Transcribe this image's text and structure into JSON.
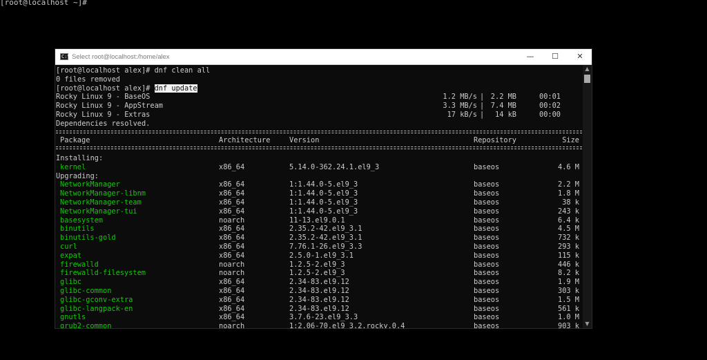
{
  "background_prompt": "[root@localhost ~]#",
  "window": {
    "title": "Select root@localhost:/home/alex",
    "icon_label": "C:\\",
    "minimize_glyph": "—",
    "maximize_glyph": "☐",
    "close_glyph": "✕"
  },
  "terminal": {
    "cmd1": "[root@localhost alex]# dnf clean all",
    "cmd1_output": "0 files removed",
    "cmd2_prompt": "[root@localhost alex]# ",
    "cmd2_command": "dnf update",
    "repos": [
      {
        "name": "Rocky Linux 9 - BaseOS",
        "speed": "1.2 MB/s",
        "size": "2.2 MB",
        "time": "00:01"
      },
      {
        "name": "Rocky Linux 9 - AppStream",
        "speed": "3.3 MB/s",
        "size": "7.4 MB",
        "time": "00:02"
      },
      {
        "name": "Rocky Linux 9 - Extras",
        "speed": "17 kB/s",
        "size": "14 kB",
        "time": "00:00"
      }
    ],
    "deps_resolved": "Dependencies resolved.",
    "headers": {
      "package": "Package",
      "architecture": "Architecture",
      "version": "Version",
      "repository": "Repository",
      "size": "Size"
    },
    "installing_label": "Installing:",
    "upgrading_label": "Upgrading:",
    "installing": [
      {
        "package": "kernel",
        "arch": "x86_64",
        "version": "5.14.0-362.24.1.el9_3",
        "repo": "baseos",
        "size": "4.6 M"
      }
    ],
    "upgrading": [
      {
        "package": "NetworkManager",
        "arch": "x86_64",
        "version": "1:1.44.0-5.el9_3",
        "repo": "baseos",
        "size": "2.2 M"
      },
      {
        "package": "NetworkManager-libnm",
        "arch": "x86_64",
        "version": "1:1.44.0-5.el9_3",
        "repo": "baseos",
        "size": "1.8 M"
      },
      {
        "package": "NetworkManager-team",
        "arch": "x86_64",
        "version": "1:1.44.0-5.el9_3",
        "repo": "baseos",
        "size": "38 k"
      },
      {
        "package": "NetworkManager-tui",
        "arch": "x86_64",
        "version": "1:1.44.0-5.el9_3",
        "repo": "baseos",
        "size": "243 k"
      },
      {
        "package": "basesystem",
        "arch": "noarch",
        "version": "11-13.el9.0.1",
        "repo": "baseos",
        "size": "6.4 k"
      },
      {
        "package": "binutils",
        "arch": "x86_64",
        "version": "2.35.2-42.el9_3.1",
        "repo": "baseos",
        "size": "4.5 M"
      },
      {
        "package": "binutils-gold",
        "arch": "x86_64",
        "version": "2.35.2-42.el9_3.1",
        "repo": "baseos",
        "size": "732 k"
      },
      {
        "package": "curl",
        "arch": "x86_64",
        "version": "7.76.1-26.el9_3.3",
        "repo": "baseos",
        "size": "293 k"
      },
      {
        "package": "expat",
        "arch": "x86_64",
        "version": "2.5.0-1.el9_3.1",
        "repo": "baseos",
        "size": "115 k"
      },
      {
        "package": "firewalld",
        "arch": "noarch",
        "version": "1.2.5-2.el9_3",
        "repo": "baseos",
        "size": "446 k"
      },
      {
        "package": "firewalld-filesystem",
        "arch": "noarch",
        "version": "1.2.5-2.el9_3",
        "repo": "baseos",
        "size": "8.2 k"
      },
      {
        "package": "glibc",
        "arch": "x86_64",
        "version": "2.34-83.el9.12",
        "repo": "baseos",
        "size": "1.9 M"
      },
      {
        "package": "glibc-common",
        "arch": "x86_64",
        "version": "2.34-83.el9.12",
        "repo": "baseos",
        "size": "303 k"
      },
      {
        "package": "glibc-gconv-extra",
        "arch": "x86_64",
        "version": "2.34-83.el9.12",
        "repo": "baseos",
        "size": "1.5 M"
      },
      {
        "package": "glibc-langpack-en",
        "arch": "x86_64",
        "version": "2.34-83.el9.12",
        "repo": "baseos",
        "size": "561 k"
      },
      {
        "package": "gnutls",
        "arch": "x86_64",
        "version": "3.7.6-23.el9_3.3",
        "repo": "baseos",
        "size": "1.0 M"
      },
      {
        "package": "grub2-common",
        "arch": "noarch",
        "version": "1:2.06-70.el9_3.2.rocky.0.4",
        "repo": "baseos",
        "size": "903 k"
      }
    ]
  },
  "scrollbar": {
    "up_glyph": "▲",
    "down_glyph": "▼"
  },
  "colors": {
    "terminal_bg": "#0c0c0c",
    "terminal_fg": "#cccccc",
    "package_green": "#16c60c",
    "selection_bg": "#f2f2f2"
  }
}
